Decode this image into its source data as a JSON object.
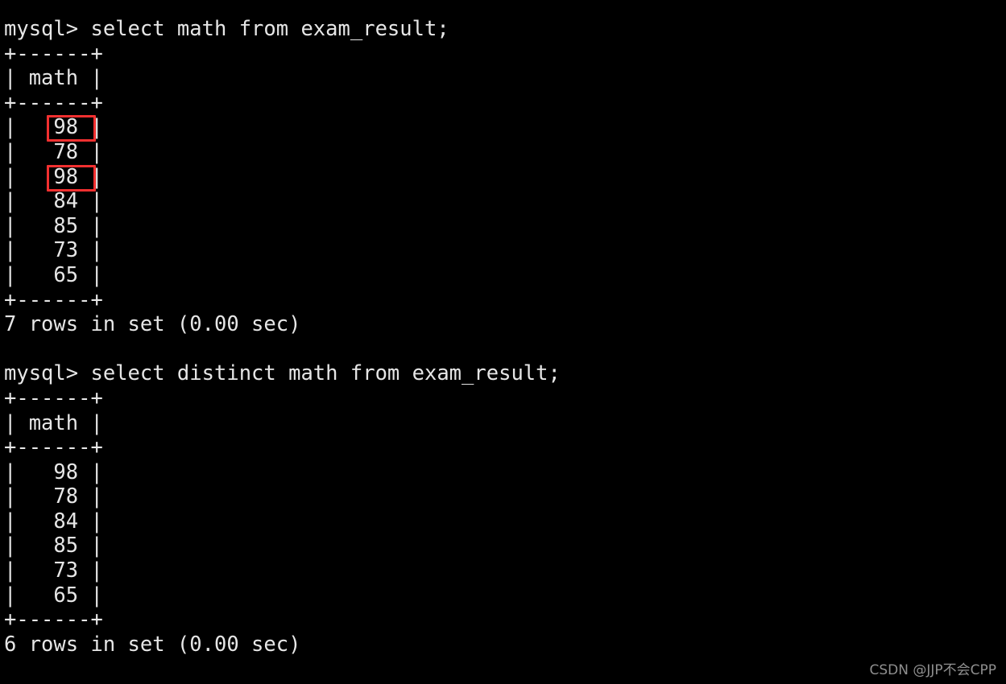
{
  "terminal": {
    "background_color": "#000000",
    "text_color": "#e6e6e6",
    "prompt": "mysql>",
    "blocks": [
      {
        "command_line": "mysql> select math from exam_result;",
        "table": {
          "top_border": "+------+",
          "header_row": "| math |",
          "header_separator": "+------+",
          "rows": [
            "|   98 |",
            "|   78 |",
            "|   98 |",
            "|   84 |",
            "|   85 |",
            "|   73 |",
            "|   65 |"
          ],
          "bottom_border": "+------+"
        },
        "status": "7 rows in set (0.00 sec)"
      },
      {
        "command_line": "mysql> select distinct math from exam_result;",
        "table": {
          "top_border": "+------+",
          "header_row": "| math |",
          "header_separator": "+------+",
          "rows": [
            "|   98 |",
            "|   78 |",
            "|   84 |",
            "|   85 |",
            "|   73 |",
            "|   65 |"
          ],
          "bottom_border": "+------+"
        },
        "status": "6 rows in set (0.00 sec)"
      }
    ],
    "blank_line": ""
  },
  "annotations": {
    "color": "#f23030",
    "boxes": [
      {
        "label": "98",
        "note": "duplicate-value-first"
      },
      {
        "label": "98",
        "note": "duplicate-value-second"
      }
    ]
  },
  "watermark": {
    "text": "CSDN @JJP不会CPP",
    "color": "#8f8f8f"
  },
  "chart_data": {
    "type": "table",
    "title": "exam_result.math",
    "columns": [
      "math"
    ],
    "all_values": [
      98,
      78,
      98,
      84,
      85,
      73,
      65
    ],
    "distinct_values": [
      98,
      78,
      84,
      85,
      73,
      65
    ],
    "all_row_count": 7,
    "distinct_row_count": 6,
    "highlighted_values": [
      98,
      98
    ]
  }
}
